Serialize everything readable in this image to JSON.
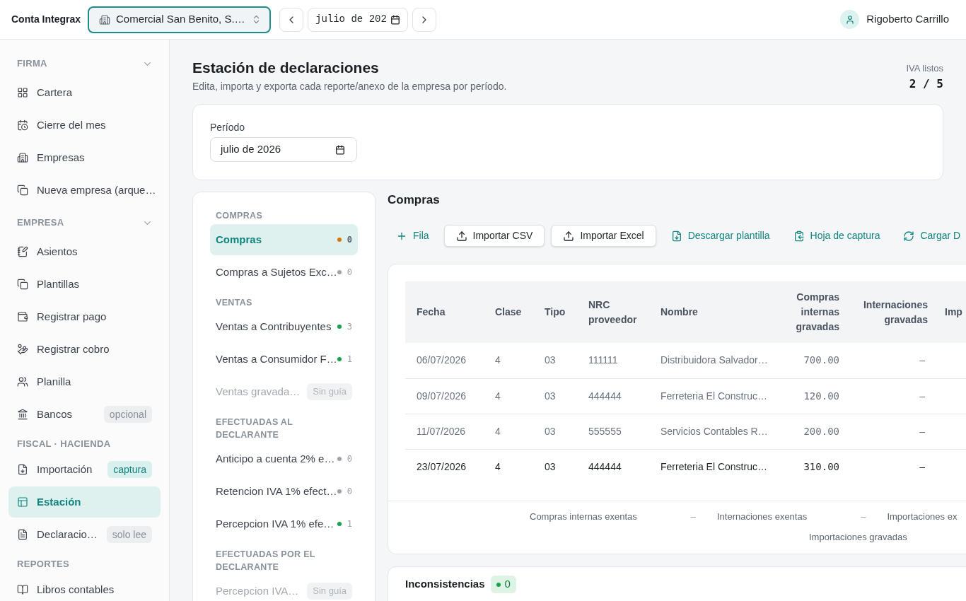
{
  "app": {
    "name": "Conta Integrax"
  },
  "topbar": {
    "company": "Comercial San Benito, S.…",
    "month": "julio de 202",
    "user": "Rigoberto Carrillo"
  },
  "sidebar": [
    {
      "title": "FIRMA",
      "collapsible": true,
      "expanded": true,
      "items": [
        {
          "label": "Cartera",
          "selected": false
        },
        {
          "label": "Cierre del mes",
          "selected": false
        },
        {
          "label": "Empresas",
          "selected": false
        },
        {
          "label": "Nueva empresa (arque…",
          "selected": false
        }
      ]
    },
    {
      "title": "EMPRESA",
      "collapsible": true,
      "expanded": true,
      "items": [
        {
          "label": "Asientos",
          "selected": false
        },
        {
          "label": "Plantillas",
          "selected": false
        },
        {
          "label": "Registrar pago",
          "selected": false
        },
        {
          "label": "Registrar cobro",
          "selected": false
        },
        {
          "label": "Planilla",
          "selected": false
        },
        {
          "label": "Bancos",
          "selected": false,
          "badge": {
            "text": "opcional",
            "kind": "neutral"
          }
        }
      ]
    },
    {
      "title": "FISCAL · HACIENDA",
      "collapsible": false,
      "items": [
        {
          "label": "Importación",
          "selected": false,
          "badge": {
            "text": "captura",
            "kind": "accent"
          }
        },
        {
          "label": "Estación",
          "selected": true
        },
        {
          "label": "Declaracio…",
          "selected": false,
          "badge": {
            "text": "solo lee",
            "kind": "neutral"
          }
        }
      ]
    },
    {
      "title": "REPORTES",
      "collapsible": false,
      "items": [
        {
          "label": "Libros contables",
          "selected": false
        }
      ]
    }
  ],
  "page": {
    "title": "Estación de declaraciones",
    "subtitle": "Edita, importa y exporta cada reporte/anexo de la empresa por período.",
    "stat": {
      "label": "IVA listos",
      "value": "2 / 5"
    }
  },
  "period": {
    "label": "Período",
    "value": "julio de 2026"
  },
  "reports": [
    {
      "title": "COMPRAS",
      "items": [
        {
          "label": "Compras",
          "selected": true,
          "disabled": false,
          "color": "#d97706",
          "count": "0"
        },
        {
          "label": "Compras a Sujetos Exc…",
          "selected": false,
          "disabled": false,
          "color": "#9ca3af",
          "count": "0"
        }
      ]
    },
    {
      "title": "VENTAS",
      "items": [
        {
          "label": "Ventas a Contribuyentes",
          "selected": false,
          "disabled": false,
          "color": "#16a34a",
          "count": "3"
        },
        {
          "label": "Ventas a Consumidor F…",
          "selected": false,
          "disabled": false,
          "color": "#16a34a",
          "count": "1"
        },
        {
          "label": "Ventas gravada…",
          "selected": false,
          "disabled": true,
          "badge": "Sin guía"
        }
      ]
    },
    {
      "title": "EFECTUADAS AL DECLARANTE",
      "items": [
        {
          "label": "Anticipo a cuenta 2% e…",
          "selected": false,
          "disabled": false,
          "color": "#9ca3af",
          "count": "0"
        },
        {
          "label": "Retencion IVA 1% efect…",
          "selected": false,
          "disabled": false,
          "color": "#9ca3af",
          "count": "0"
        },
        {
          "label": "Percepcion IVA 1% efe…",
          "selected": false,
          "disabled": false,
          "color": "#16a34a",
          "count": "1"
        }
      ]
    },
    {
      "title": "EFECTUADAS POR EL DECLARANTE",
      "items": [
        {
          "label": "Percepcion IVA…",
          "selected": false,
          "disabled": true,
          "badge": "Sin guía"
        }
      ]
    }
  ],
  "section": {
    "title": "Compras",
    "toolbar": [
      {
        "kind": "text",
        "label": "Fila"
      },
      {
        "kind": "outline",
        "label": "Importar CSV"
      },
      {
        "kind": "outline",
        "label": "Importar Excel"
      },
      {
        "kind": "text",
        "label": "Descargar plantilla"
      },
      {
        "kind": "text",
        "label": "Hoja de captura"
      },
      {
        "kind": "text",
        "label": "Cargar D"
      }
    ]
  },
  "table": {
    "columns": [
      "Fecha",
      "Clase",
      "Tipo",
      "NRC proveedor",
      "Nombre",
      "Compras internas gravadas",
      "Internaciones gravadas",
      "Imp"
    ],
    "rows": [
      {
        "muted": true,
        "cells": [
          "06/07/2026",
          "4",
          "03",
          "111111",
          "Distribuidora Salvador…",
          "700.00",
          "–"
        ]
      },
      {
        "muted": true,
        "cells": [
          "09/07/2026",
          "4",
          "03",
          "444444",
          "Ferreteria El Construc…",
          "120.00",
          "–"
        ]
      },
      {
        "muted": true,
        "cells": [
          "11/07/2026",
          "4",
          "03",
          "555555",
          "Servicios Contables R…",
          "200.00",
          "–"
        ]
      },
      {
        "muted": false,
        "cells": [
          "23/07/2026",
          "4",
          "03",
          "444444",
          "Ferreteria El Construc…",
          "310.00",
          "–"
        ]
      }
    ],
    "totals": [
      {
        "items": [
          {
            "label": "Compras internas exentas",
            "value": "–"
          },
          {
            "label": "Internaciones exentas",
            "value": "–"
          },
          {
            "label": "Importaciones ex"
          }
        ]
      },
      {
        "items": [
          {
            "label": "Importaciones gravadas"
          }
        ]
      }
    ]
  },
  "inconsistencies": {
    "title": "Inconsistencias",
    "count": "0"
  }
}
